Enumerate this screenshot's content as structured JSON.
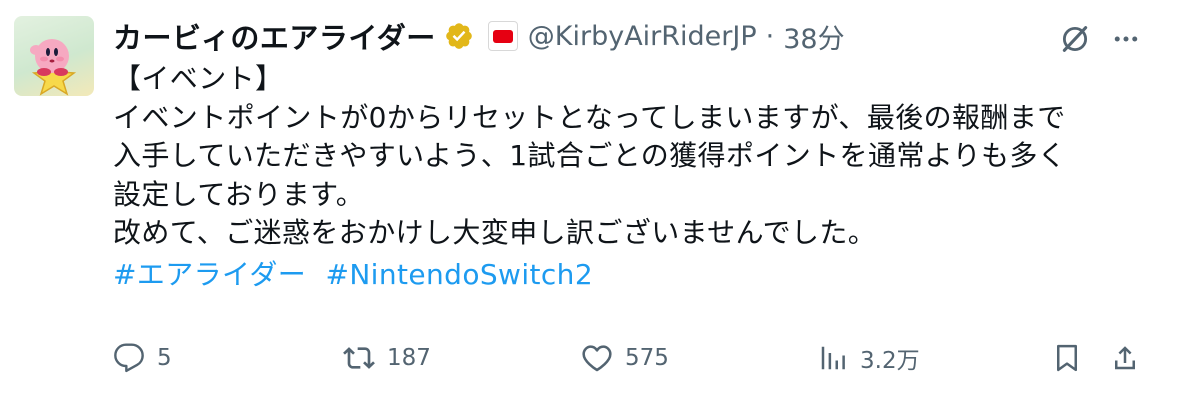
{
  "user": {
    "display_name": "カービィのエアライダー",
    "handle": "@KirbyAirRiderJP",
    "separator": "·",
    "time": "38分",
    "verified_color": "#e2b719",
    "affiliate_badge_color": "#e60012"
  },
  "tweet": {
    "lines": [
      "【イベント】",
      "イベントポイントが0からリセットとなってしまいますが、最後の報酬まで",
      "入手していただきやすいよう、1試合ごとの獲得ポイントを通常よりも多く",
      "設定しております。",
      "改めて、ご迷惑をおかけし大変申し訳ございませんでした。"
    ],
    "hashtags": [
      "#エアライダー",
      "#NintendoSwitch2"
    ],
    "hashtag_color": "#1d9bf0"
  },
  "actions": {
    "reply_count": "5",
    "retweet_count": "187",
    "like_count": "575",
    "views_count": "3.2万"
  },
  "icons": {
    "avatar": "kirby-on-star-avatar",
    "verified": "verified-badge-icon",
    "affiliate": "nintendo-affiliate-icon",
    "grok": "grok-icon",
    "more": "more-dots-icon",
    "reply": "reply-icon",
    "retweet": "retweet-icon",
    "like": "heart-icon",
    "views": "views-chart-icon",
    "bookmark": "bookmark-icon",
    "share": "share-icon"
  },
  "colors": {
    "text": "#0f1419",
    "muted": "#536471",
    "link": "#1d9bf0"
  }
}
